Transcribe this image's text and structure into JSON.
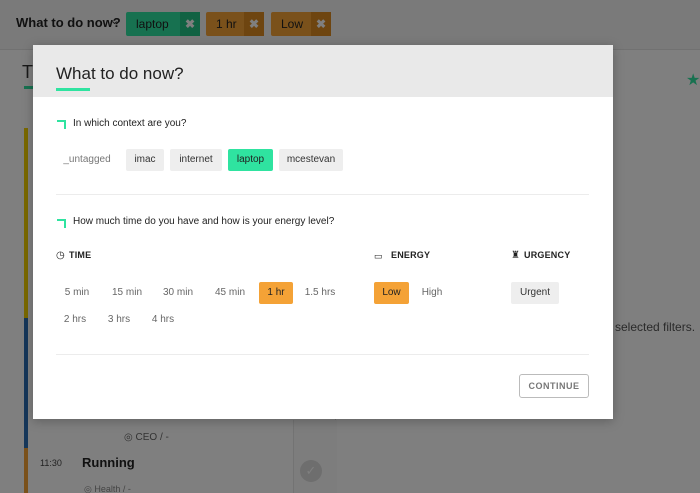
{
  "topbar": {
    "title": "What to do now?",
    "filters": [
      {
        "label": "laptop",
        "color": "#2fe3a0"
      },
      {
        "label": "1 hr",
        "color": "#f4a236"
      },
      {
        "label": "Low",
        "color": "#f4a236"
      }
    ]
  },
  "background": {
    "tab_letter": "T",
    "list_meta": "CEO / -",
    "item_time": "11:30",
    "item_title": "Running",
    "item_meta": "Health / -",
    "hint": "selected filters."
  },
  "modal": {
    "title": "What to do now?",
    "context_question": "In which context are you?",
    "contexts": [
      "_untagged",
      "imac",
      "internet",
      "laptop",
      "mcestevan"
    ],
    "selected_context": "laptop",
    "time_question": "How much time do you have and how is your energy level?",
    "time_header": "TIME",
    "energy_header": "ENERGY",
    "urgency_header": "URGENCY",
    "time_options": [
      "5 min",
      "15 min",
      "30 min",
      "45 min",
      "1 hr",
      "1.5 hrs",
      "2 hrs",
      "3 hrs",
      "4 hrs"
    ],
    "selected_time": "1 hr",
    "energy_options": [
      "Low",
      "High"
    ],
    "selected_energy": "Low",
    "urgency_option": "Urgent",
    "continue_label": "CONTINUE"
  },
  "colors": {
    "context_accent": "#2fe3a0",
    "time_accent": "#f4a236"
  }
}
